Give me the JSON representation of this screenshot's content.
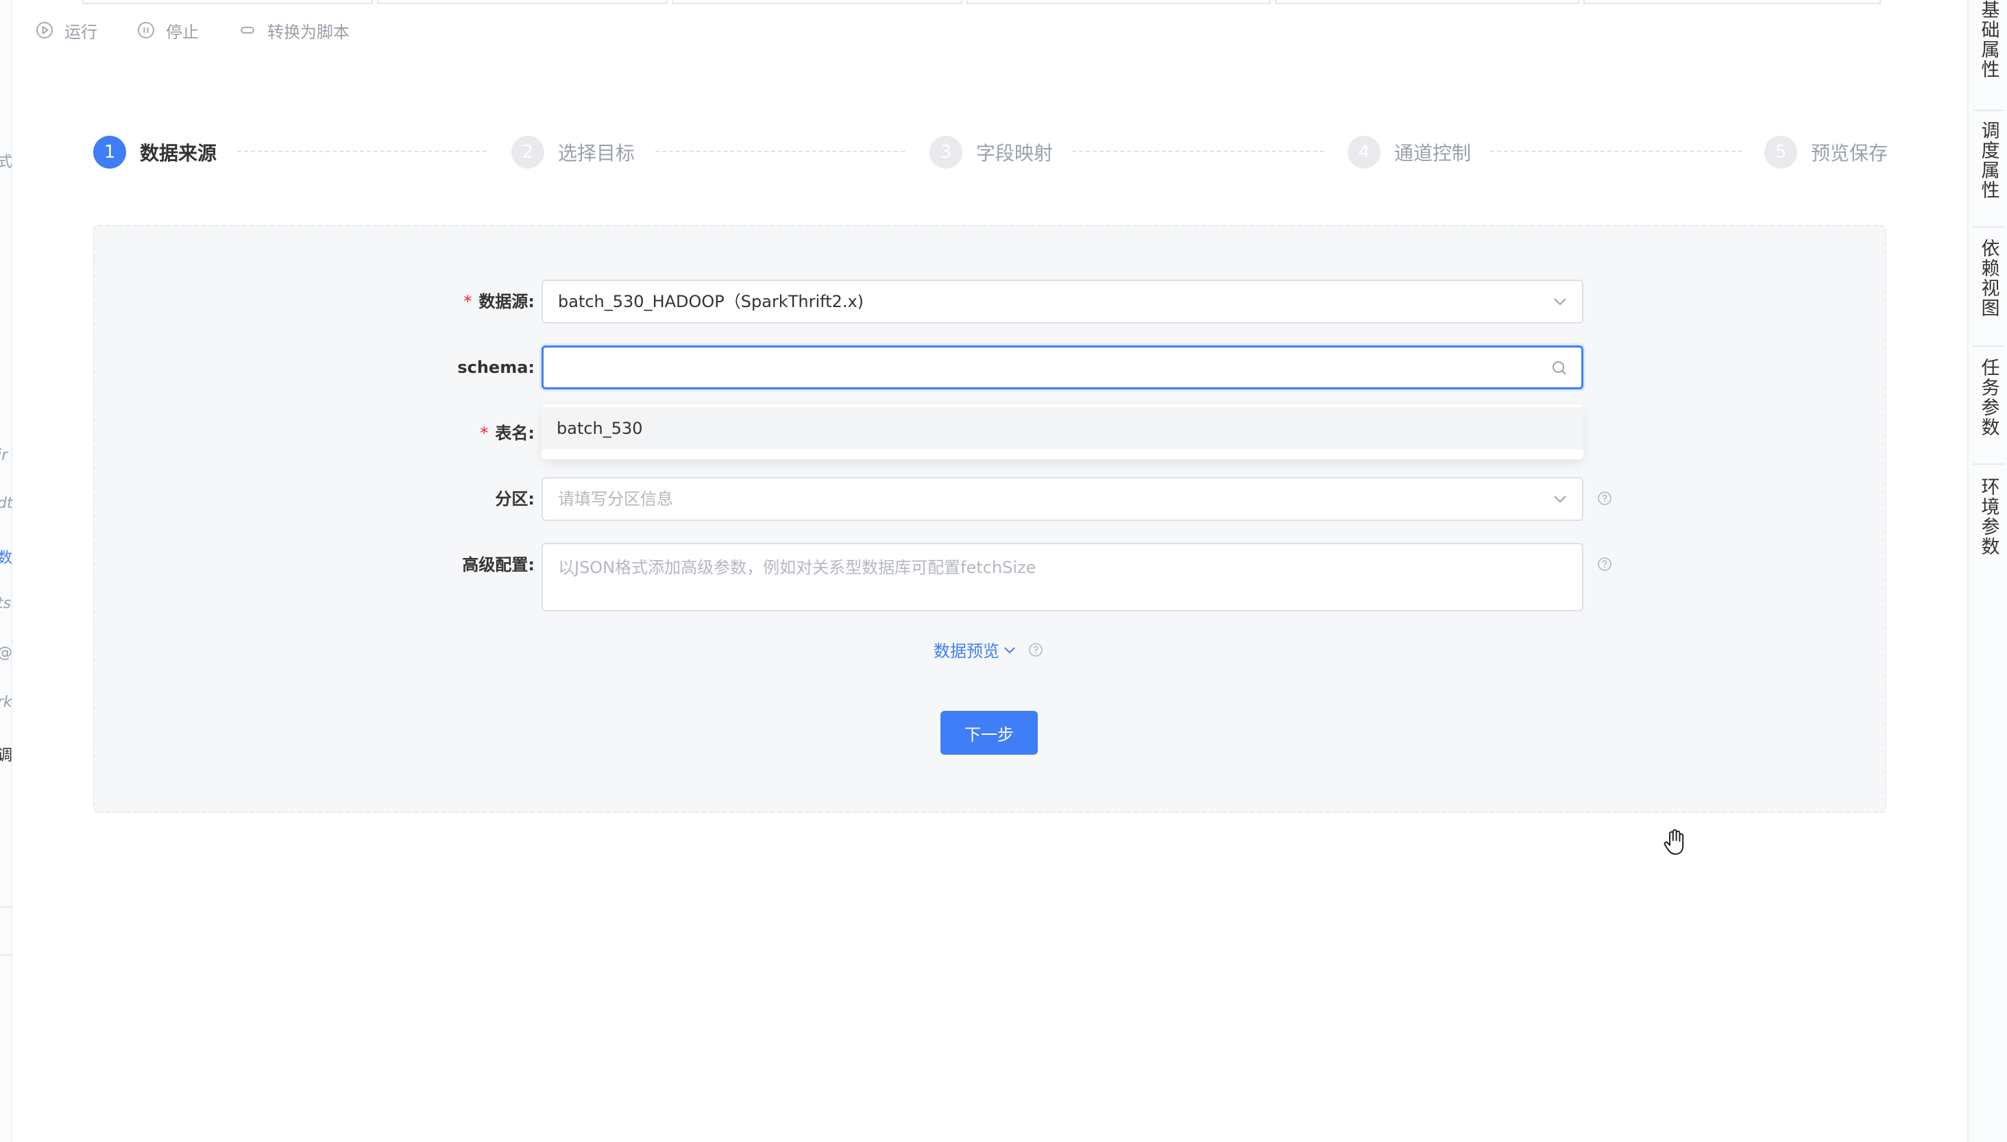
{
  "toolbar": {
    "run_label": "运行",
    "stop_label": "停止",
    "convert_label": "转换为脚本"
  },
  "steps": [
    {
      "num": "1",
      "label": "数据来源"
    },
    {
      "num": "2",
      "label": "选择目标"
    },
    {
      "num": "3",
      "label": "字段映射"
    },
    {
      "num": "4",
      "label": "通道控制"
    },
    {
      "num": "5",
      "label": "预览保存"
    }
  ],
  "form": {
    "datasource": {
      "label": "数据源",
      "required": "*",
      "value": "batch_530_HADOOP（SparkThrift2.x)"
    },
    "schema": {
      "label": "schema",
      "value": ""
    },
    "table": {
      "label": "表名",
      "required": "*",
      "option": "batch_530"
    },
    "partition": {
      "label": "分区",
      "placeholder": "请填写分区信息"
    },
    "advanced": {
      "label": "高级配置",
      "placeholder": "以JSON格式添加高级参数，例如对关系型数据库可配置fetchSize"
    },
    "colon": ":"
  },
  "preview_label": "数据预览",
  "next_button": "下一步",
  "right_tabs": [
    "基础属性",
    "调度属性",
    "依赖视图",
    "任务参数",
    "环境参数"
  ],
  "left_rail_glyphs": [
    "式",
    "ir",
    "dt",
    "数",
    "ts",
    "@",
    "rk",
    "调"
  ],
  "colors": {
    "accent": "#3f7ef7",
    "required": "#f5222d"
  }
}
